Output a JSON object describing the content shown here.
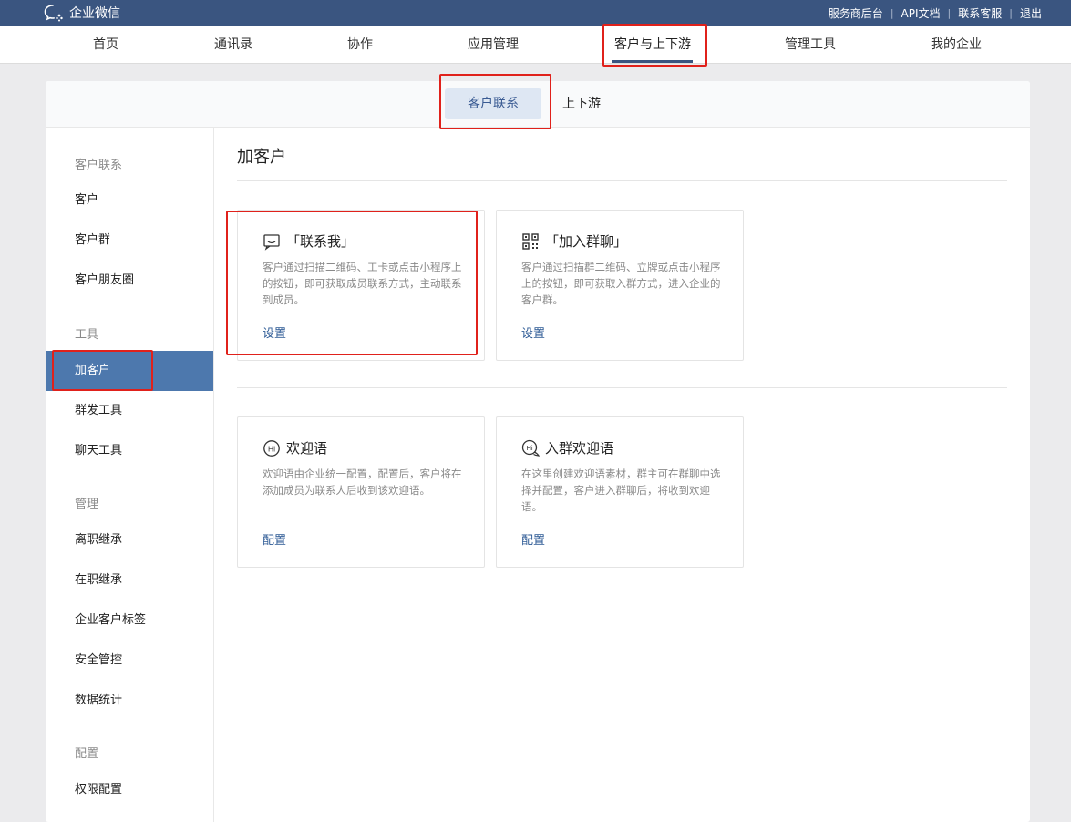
{
  "app": {
    "brand": "企业微信"
  },
  "toplinks": [
    "服务商后台",
    "API文档",
    "联系客服",
    "退出"
  ],
  "mainnav": [
    {
      "label": "首页"
    },
    {
      "label": "通讯录"
    },
    {
      "label": "协作"
    },
    {
      "label": "应用管理"
    },
    {
      "label": "客户与上下游",
      "active": true
    },
    {
      "label": "管理工具"
    },
    {
      "label": "我的企业"
    }
  ],
  "subnav": {
    "active": "客户联系",
    "inactive": "上下游"
  },
  "sidebar": {
    "groups": [
      {
        "title": "客户联系",
        "items": [
          "客户",
          "客户群",
          "客户朋友圈"
        ]
      },
      {
        "title": "工具",
        "items": [
          "加客户",
          "群发工具",
          "聊天工具"
        ]
      },
      {
        "title": "管理",
        "items": [
          "离职继承",
          "在职继承",
          "企业客户标签",
          "安全管控",
          "数据统计"
        ]
      },
      {
        "title": "配置",
        "items": [
          "权限配置"
        ]
      }
    ],
    "active_item": "加客户"
  },
  "content": {
    "title": "加客户",
    "cards": [
      {
        "icon": "contact-me-icon",
        "title": "「联系我」",
        "desc": "客户通过扫描二维码、工卡或点击小程序上的按钮，即可获取成员联系方式，主动联系到成员。",
        "link": "设置"
      },
      {
        "icon": "qr-code-icon",
        "title": "「加入群聊」",
        "desc": "客户通过扫描群二维码、立牌或点击小程序上的按钮，即可获取入群方式，进入企业的客户群。",
        "link": "设置"
      },
      {
        "icon": "hi-icon",
        "title": "欢迎语",
        "desc": "欢迎语由企业统一配置，配置后，客户将在添加成员为联系人后收到该欢迎语。",
        "link": "配置"
      },
      {
        "icon": "group-hi-icon",
        "title": "入群欢迎语",
        "desc": "在这里创建欢迎语素材，群主可在群聊中选择并配置，客户进入群聊后，将收到欢迎语。",
        "link": "配置"
      }
    ]
  },
  "colors": {
    "topbar": "#3a5580",
    "active_sidebar": "#4d78ad",
    "link": "#2d5a95",
    "highlight": "#e0211b"
  }
}
